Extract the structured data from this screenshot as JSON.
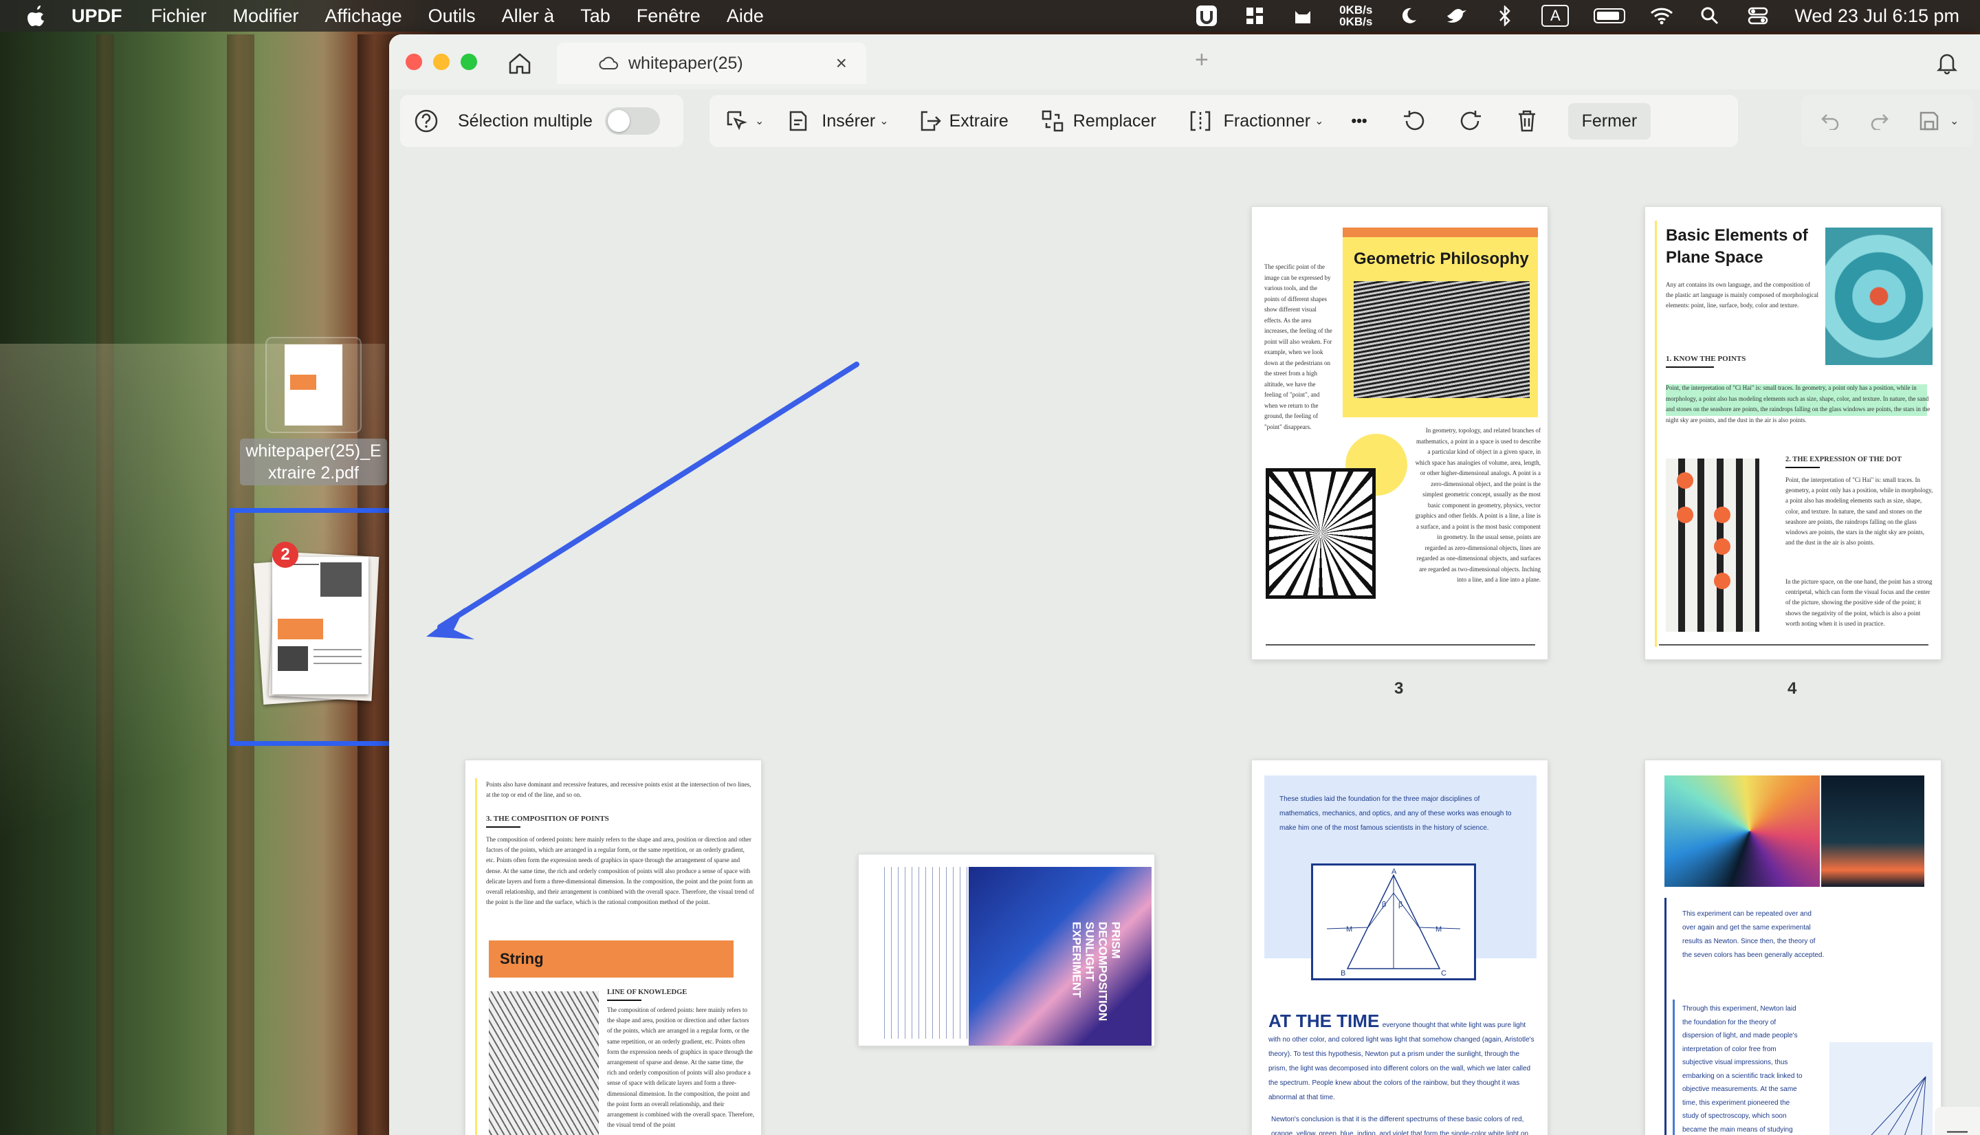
{
  "menubar": {
    "app_name": "UPDF",
    "items": [
      "Fichier",
      "Modifier",
      "Affichage",
      "Outils",
      "Aller à",
      "Tab",
      "Fenêtre",
      "Aide"
    ],
    "net_up": "0KB/s",
    "net_down": "0KB/s",
    "input_source": "A",
    "datetime": "Wed 23 Jul  6:15 pm"
  },
  "desktop": {
    "file1_name_line1": "whitepaper(25)_E",
    "file1_name_line2": "xtraire 2.pdf",
    "drag_count": "2"
  },
  "tab": {
    "title": "whitepaper(25)"
  },
  "toolbar": {
    "multi_select_label": "Sélection multiple",
    "insert_label": "Insérer",
    "extract_label": "Extraire",
    "replace_label": "Remplacer",
    "split_label": "Fractionner",
    "more_label": "•••",
    "close_label": "Fermer"
  },
  "pages": {
    "p3": {
      "number": "3",
      "title": "Geometric Philosophy",
      "left_text": "The specific point of the image can be expressed by various tools, and the points of different shapes show different visual effects. As the area increases, the feeling of the point will also weaken. For example, when we look down at the pedestrians on the street from a high altitude, we have the feeling of \"point\", and when we return to the ground, the feeling of \"point\" disappears.",
      "right_text": "In geometry, topology, and related branches of mathematics, a point in a space is used to describe a particular kind of object in a given space, in which space has analogies of volume, area, length, or other higher-dimensional analogs. A point is a zero-dimensional object, and the point is the simplest geometric concept, usually as the most basic component in geometry, physics, vector graphics and other fields. A point is a line, a line is a surface, and a point is the most basic component in geometry. In the usual sense, points are regarded as zero-dimensional objects, lines are regarded as one-dimensional objects, and surfaces are regarded as two-dimensional objects. Inching into a line, and a line into a plane."
    },
    "p4": {
      "number": "4",
      "title": "Basic Elements of Plane Space",
      "intro": "Any art contains its own language, and the composition of the plastic art language is mainly composed of morphological elements: point, line, surface, body, color and texture.",
      "h1": "1. KNOW THE POINTS",
      "p1": "Point, the interpretation of \"Ci Hai\" is: small traces. In geometry, a point only has a position, while in morphology, a point also has modeling elements such as size, shape, color, and texture. In nature, the sand and stones on the seashore are points, the raindrops falling on the glass windows are points, the stars in the night sky are points, and the dust in the air is also points.",
      "h2": "2. THE EXPRESSION OF THE DOT",
      "p2": "Point, the interpretation of \"Ci Hai\" is: small traces. In geometry, a point only has a position, while in morphology, a point also has modeling elements such as size, shape, color, and texture. In nature, the sand and stones on the seashore are points, the raindrops falling on the glass windows are points, the stars in the night sky are points, and the dust in the air is also points.",
      "p3": "In the picture space, on the one hand, the point has a strong centripetal, which can form the visual focus and the center of the picture, showing the positive side of the point; it shows the negativity of the point, which is also a point worth noting when it is used in practice."
    },
    "p5": {
      "intro": "Points also have dominant and recessive features, and recessive points exist at the intersection of two lines, at the top or end of the line, and so on.",
      "h1": "3. THE COMPOSITION OF POINTS",
      "p1": "The composition of ordered points: here mainly refers to the shape and area, position or direction and other factors of the points, which are arranged in a regular form, or the same repetition, or an orderly gradient, etc. Points often form the expression needs of graphics in space through the arrangement of sparse and dense. At the same time, the rich and orderly composition of points will also produce a sense of space with delicate layers and form a three-dimensional dimension. In the composition, the point and the point form an overall relationship, and their arrangement is combined with the overall space. Therefore, the visual trend of the point is the line and the surface, which is the rational composition method of the point.",
      "band": "String",
      "h2": "LINE OF KNOWLEDGE",
      "p2": "The composition of ordered points: here mainly refers to the shape and area, position or direction and other factors of the points, which are arranged in a regular form, or the same repetition, or an orderly gradient, etc. Points often form the expression needs of graphics in space through the arrangement of sparse and dense. At the same time, the rich and orderly composition of points will also produce a sense of space with delicate layers and form a three-dimensional dimension. In the composition, the point and the point form an overall relationship, and their arrangement is combined with the overall space. Therefore, the visual trend of the point"
    },
    "p6": {
      "title": "PRISM DECOMPOSITION SUNLIGHT EXPERIMENT"
    },
    "p7": {
      "intro": "These studies laid the foundation for the three major disciplines of mathematics, mechanics, and optics, and any of these works was enough to make him one of the most famous scientists in the history of science.",
      "labels": [
        "A",
        "M",
        "β",
        "β",
        "M",
        "B",
        "C"
      ],
      "heading": "AT THE TIME",
      "body": "everyone thought that white light was pure light with no other color, and colored light was light that somehow changed (again, Aristotle's theory). To test this hypothesis, Newton put a prism under the sunlight, through the prism, the light was decomposed into different colors on the wall, which we later called the spectrum. People knew about the colors of the rainbow, but they thought it was abnormal at that time.",
      "body2": "Newton's conclusion is that it is the different spectrums of these basic colors of red, orange, yellow, green, blue, indigo, and violet that form the single-color white light on the surface."
    },
    "p8": {
      "p1": "This experiment can be repeated over and over again and get the same experimental results as Newton. Since then, the theory of the seven colors has been generally accepted.",
      "p2": "Through this experiment, Newton laid the foundation for the theory of dispersion of light, and made people's interpretation of color free from subjective visual impressions, thus embarking on a scientific track linked to objective measurements. At the same time, this experiment pioneered the study of spectroscopy, which soon became the main means of studying optics and the structure"
    }
  },
  "side_tool": {
    "label": "—"
  },
  "colors": {
    "accent_blue": "#2f5ff0",
    "orange": "#f08a44",
    "yellow": "#fde86a"
  }
}
